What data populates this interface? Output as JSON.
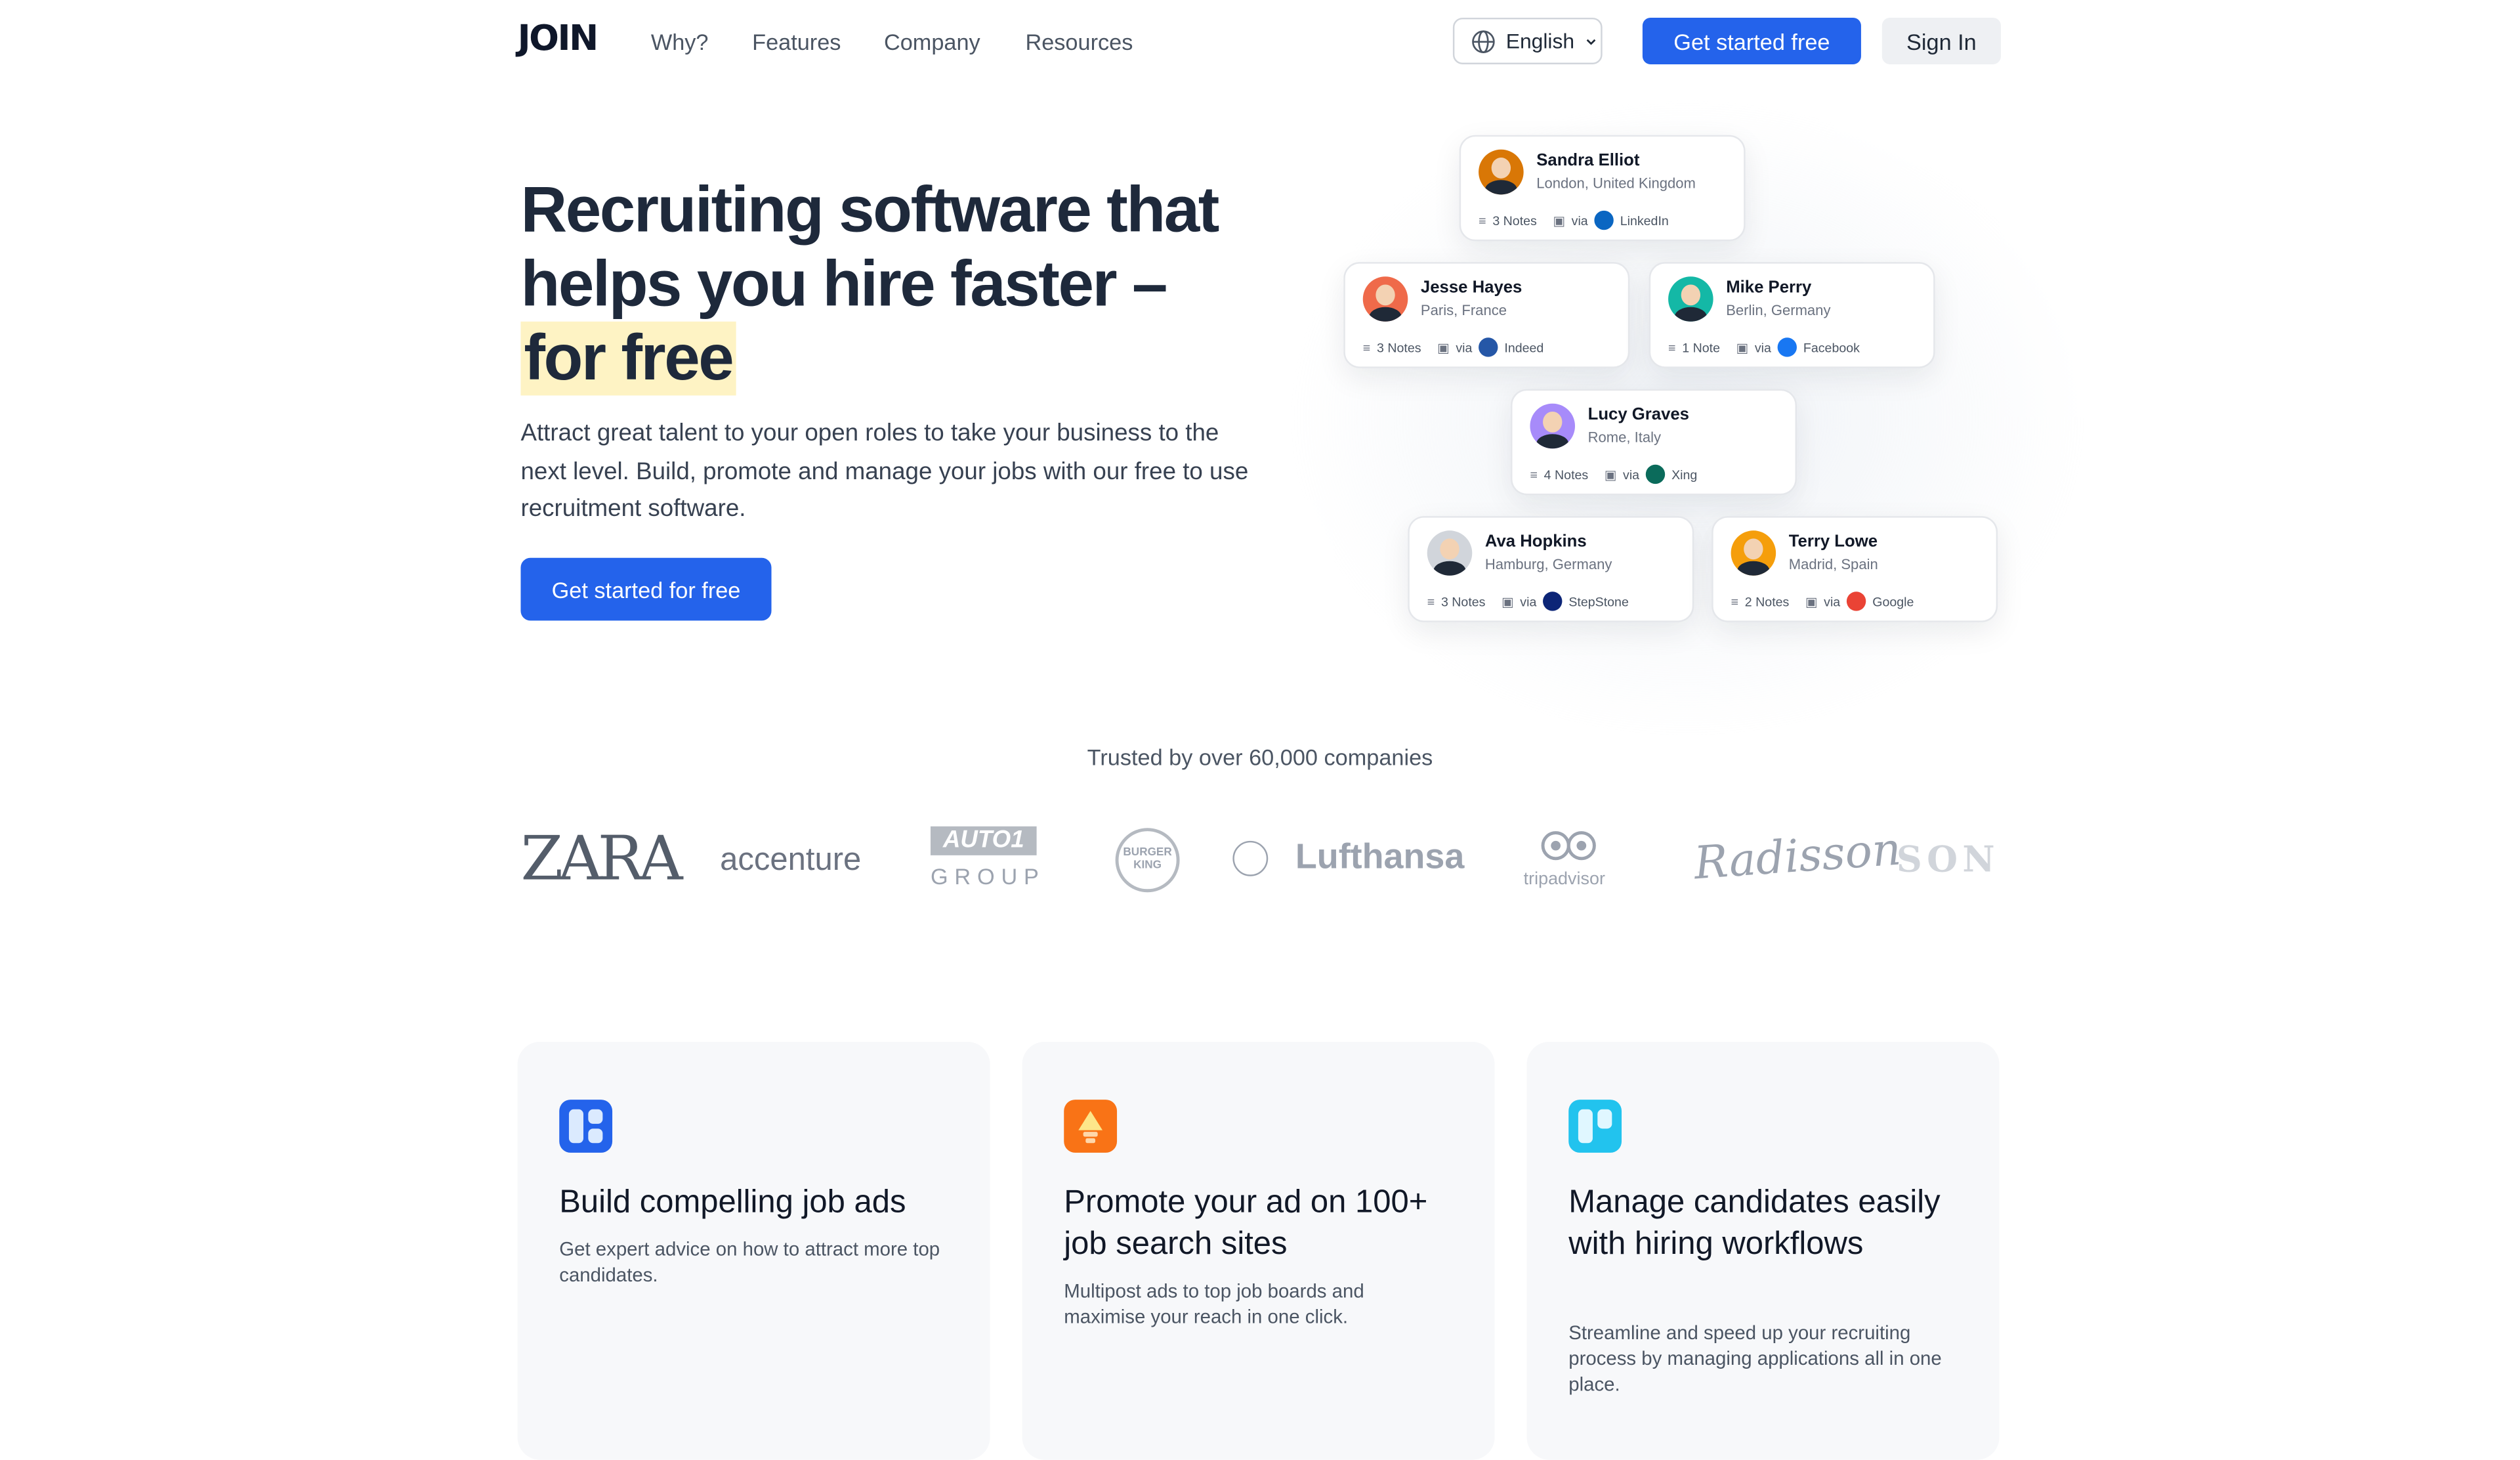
{
  "header": {
    "logo": "JOIN",
    "nav": [
      "Why?",
      "Features",
      "Company",
      "Resources"
    ],
    "language": "English",
    "cta": "Get started free",
    "signin": "Sign In"
  },
  "hero": {
    "title_line1": "Recruiting software that",
    "title_line2": "helps you hire faster –",
    "title_highlight": "for free",
    "subtitle": "Attract great talent to your open roles to take your business to the next level. Build, promote and manage your jobs with our free to use recruitment software.",
    "cta": "Get started for free"
  },
  "candidates": [
    {
      "name": "Sandra Elliot",
      "location": "London, United Kingdom",
      "notes": "3 Notes",
      "via": "via",
      "source": "LinkedIn",
      "source_color": "#0a66c2",
      "avatar_color": "#d97706"
    },
    {
      "name": "Jesse Hayes",
      "location": "Paris, France",
      "notes": "3 Notes",
      "via": "via",
      "source": "Indeed",
      "source_color": "#2557a7",
      "avatar_color": "#ef6a4a"
    },
    {
      "name": "Mike Perry",
      "location": "Berlin, Germany",
      "notes": "1 Note",
      "via": "via",
      "source": "Facebook",
      "source_color": "#1877f2",
      "avatar_color": "#14b8a6"
    },
    {
      "name": "Lucy Graves",
      "location": "Rome, Italy",
      "notes": "4 Notes",
      "via": "via",
      "source": "Xing",
      "source_color": "#0b6b5b",
      "avatar_color": "#a78bfa"
    },
    {
      "name": "Ava Hopkins",
      "location": "Hamburg, Germany",
      "notes": "3 Notes",
      "via": "via",
      "source": "StepStone",
      "source_color": "#0c2577",
      "avatar_color": "#d1d5db"
    },
    {
      "name": "Terry Lowe",
      "location": "Madrid, Spain",
      "notes": "2 Notes",
      "via": "via",
      "source": "Google",
      "source_color": "#ea4335",
      "avatar_color": "#f59e0b"
    }
  ],
  "trusted": {
    "label": "Trusted by over 60,000 companies",
    "companies": [
      "ZARA",
      "accenture",
      "AUTO1",
      "GROUP",
      "BURGER KING",
      "Lufthansa",
      "tripadvisor",
      "Radisson",
      "SONY"
    ]
  },
  "features": [
    {
      "title": "Build compelling job ads",
      "desc": "Get expert advice on how to attract more top candidates.",
      "icon_color": "#2463eb"
    },
    {
      "title": "Promote your ad on 100+ job search sites",
      "desc": "Multipost ads to top job boards and maximise your reach in one click.",
      "icon_color": "#f97316"
    },
    {
      "title": "Manage candidates easily with hiring workflows",
      "desc": "Streamline and speed up your recruiting process by managing applications all in one place.",
      "icon_color": "#22c3ee"
    }
  ]
}
